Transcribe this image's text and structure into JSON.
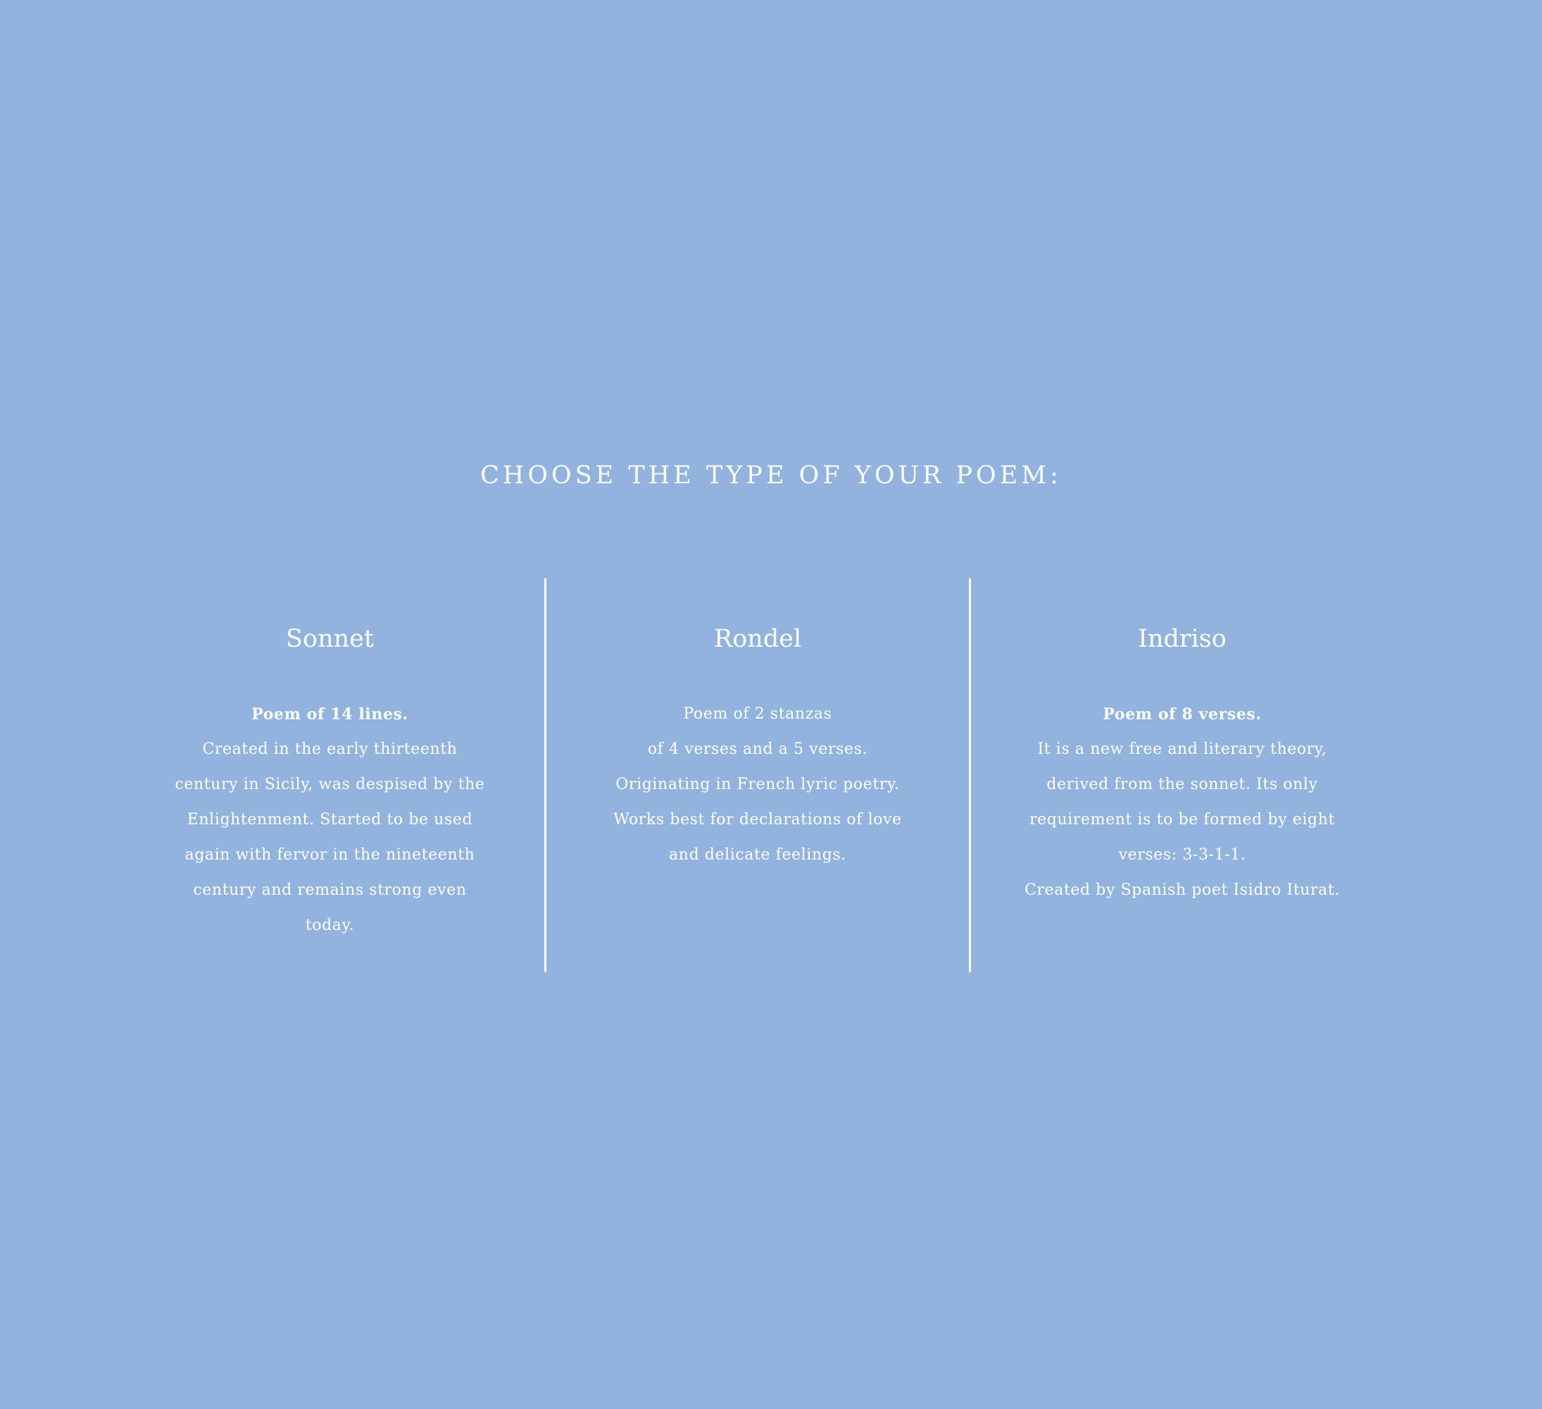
{
  "title": "CHOOSE THE TYPE OF YOUR POEM:",
  "background_color": "#91b3de",
  "options": [
    {
      "name": "Sonnet",
      "lead": "Poem of 14 lines.",
      "lines": [
        "Created in the early thirteenth",
        "century in Sicily, was despised by the",
        "Enlightenment. Started to be used",
        "again with fervor in the nineteenth",
        "century and remains strong even",
        "today."
      ]
    },
    {
      "name": "Rondel",
      "lead": "",
      "lines": [
        "Poem of 2 stanzas",
        "of 4 verses and a 5 verses.",
        "Originating in French lyric poetry.",
        "Works best for declarations of love",
        "and delicate feelings."
      ]
    },
    {
      "name": "Indriso",
      "lead": "Poem of 8 verses.",
      "lines": [
        "It is a new free and literary theory,",
        "derived from the sonnet. Its only",
        "requirement is to be formed by eight",
        "verses: 3-3-1-1.",
        "Created by Spanish poet Isidro Iturat."
      ]
    }
  ]
}
